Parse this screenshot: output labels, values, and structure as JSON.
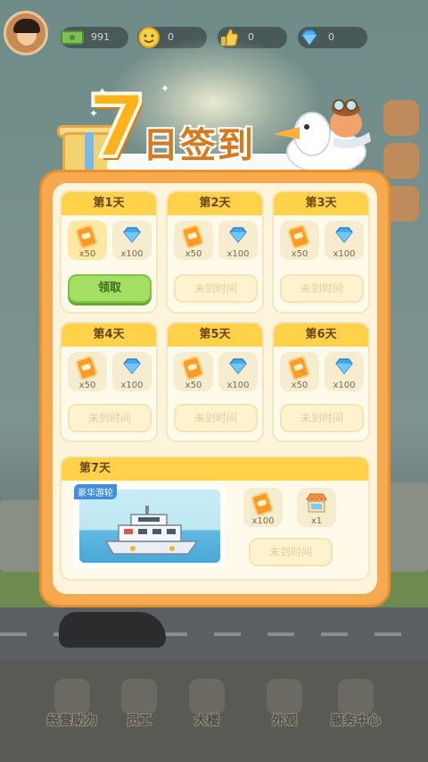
{
  "top_bar": {
    "cash": "991",
    "smile": "0",
    "likes": "0",
    "diamonds": "0"
  },
  "title": {
    "number": "7",
    "text": "日签到"
  },
  "days": [
    {
      "label": "第1天",
      "rewards": [
        {
          "qty": "x50",
          "icon": "ticket-icon"
        },
        {
          "qty": "x100",
          "icon": "diamond-icon"
        }
      ],
      "button": "领取",
      "state": "claimable"
    },
    {
      "label": "第2天",
      "rewards": [
        {
          "qty": "x50",
          "icon": "ticket-icon"
        },
        {
          "qty": "x100",
          "icon": "diamond-icon"
        }
      ],
      "button": "未到时间",
      "state": "locked"
    },
    {
      "label": "第3天",
      "rewards": [
        {
          "qty": "x50",
          "icon": "ticket-icon"
        },
        {
          "qty": "x100",
          "icon": "diamond-icon"
        }
      ],
      "button": "未到时间",
      "state": "locked"
    },
    {
      "label": "第4天",
      "rewards": [
        {
          "qty": "x50",
          "icon": "ticket-icon"
        },
        {
          "qty": "x100",
          "icon": "diamond-icon"
        }
      ],
      "button": "未到时间",
      "state": "locked"
    },
    {
      "label": "第5天",
      "rewards": [
        {
          "qty": "x50",
          "icon": "ticket-icon"
        },
        {
          "qty": "x100",
          "icon": "diamond-icon"
        }
      ],
      "button": "未到时间",
      "state": "locked"
    },
    {
      "label": "第6天",
      "rewards": [
        {
          "qty": "x50",
          "icon": "ticket-icon"
        },
        {
          "qty": "x100",
          "icon": "diamond-icon"
        }
      ],
      "button": "未到时间",
      "state": "locked"
    }
  ],
  "day7": {
    "label": "第7天",
    "showcase_tag": "豪华游轮",
    "rewards": [
      {
        "qty": "x100",
        "icon": "ticket-icon"
      },
      {
        "qty": "x1",
        "icon": "shop-icon"
      }
    ],
    "button": "未到时间"
  },
  "bottom_nav": [
    {
      "label": "经营助力",
      "icon": "boost-icon"
    },
    {
      "label": "员工",
      "icon": "staff-icon"
    },
    {
      "label": "大楼",
      "icon": "building-icon"
    },
    {
      "label": "外观",
      "icon": "palette-icon"
    },
    {
      "label": "服务中心",
      "icon": "star-icon"
    }
  ],
  "colors": {
    "accent": "#ffd24a",
    "panel": "#f6a94f",
    "claim": "#a4de63",
    "title": "#ffb21a"
  }
}
